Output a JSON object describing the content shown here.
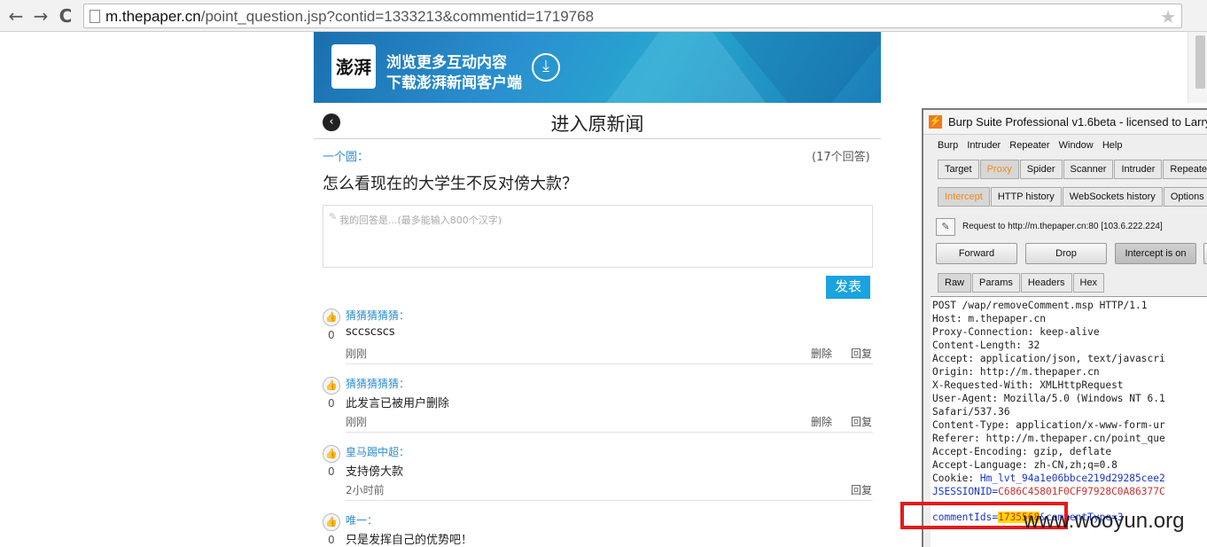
{
  "browser": {
    "nav": {
      "back": "←",
      "forward": "→",
      "reload": "C"
    },
    "url_host": "m.thepaper.cn",
    "url_rest": "/point_question.jsp?contid=1333213&commentid=1719768",
    "star": "★"
  },
  "banner": {
    "logo_text": "澎湃",
    "line1": "浏览更多互动内容",
    "line2": "下载澎湃新闻客户端",
    "download_icon": "⤓",
    "accent": "#1aa3e0"
  },
  "page": {
    "back_icon": "‹",
    "title": "进入原新闻",
    "asker": "一个圆：",
    "answer_count": "(17个回答)",
    "question": "怎么看现在的大学生不反对傍大款？",
    "reply_placeholder": "我的回答是...(最多能输入800个汉字)",
    "submit_label": "发表"
  },
  "comments": [
    {
      "user": "猜猜猜猜猜：",
      "likes": "0",
      "text": "sccscscs",
      "time": "刚刚",
      "delete": "删除",
      "reply": "回复"
    },
    {
      "user": "猜猜猜猜猜：",
      "likes": "0",
      "text": "此发言已被用户删除",
      "time": "刚刚",
      "delete": "删除",
      "reply": "回复"
    },
    {
      "user": "皇马踢中超：",
      "likes": "0",
      "text": "支持傍大款",
      "time": "2小时前",
      "delete": "",
      "reply": "回复"
    },
    {
      "user": "唯一：",
      "likes": "0",
      "text": "只是发挥自己的优势吧！",
      "time": "",
      "delete": "",
      "reply": ""
    }
  ],
  "burp": {
    "title": "Burp Suite Professional v1.6beta - licensed to Larry",
    "menu": [
      "Burp",
      "Intruder",
      "Repeater",
      "Window",
      "Help"
    ],
    "main_tabs": [
      "Target",
      "Proxy",
      "Spider",
      "Scanner",
      "Intruder",
      "Repeater"
    ],
    "sub_tabs": [
      "Intercept",
      "HTTP history",
      "WebSockets history",
      "Options"
    ],
    "request_info": "Request to http://m.thepaper.cn:80  [103.6.222.224]",
    "buttons": {
      "forward": "Forward",
      "drop": "Drop",
      "intercept": "Intercept is on"
    },
    "view_tabs": [
      "Raw",
      "Params",
      "Headers",
      "Hex"
    ],
    "request_lines": [
      "POST /wap/removeComment.msp HTTP/1.1",
      "Host: m.thepaper.cn",
      "Proxy-Connection: keep-alive",
      "Content-Length: 32",
      "Accept: application/json, text/javascri",
      "Origin: http://m.thepaper.cn",
      "X-Requested-With: XMLHttpRequest",
      "User-Agent: Mozilla/5.0 (Windows NT 6.1",
      "Safari/537.36",
      "Content-Type: application/x-www-form-ur",
      "Referer: http://m.thepaper.cn/point_que",
      "Accept-Encoding: gzip, deflate",
      "Accept-Language: zh-CN,zh;q=0.8"
    ],
    "cookie_label": "Cookie: ",
    "cookie_value": "Hm_lvt_94a1e06bbce219d29285cee2",
    "jsession_label": "JSESSIONID=",
    "jsession_value": "C686C45801F0CF97928C0A86377C",
    "body_key": "commentIds=",
    "body_id": "1735568",
    "body_rest": "&commentType=3"
  },
  "watermark": "www.wooyun.org"
}
